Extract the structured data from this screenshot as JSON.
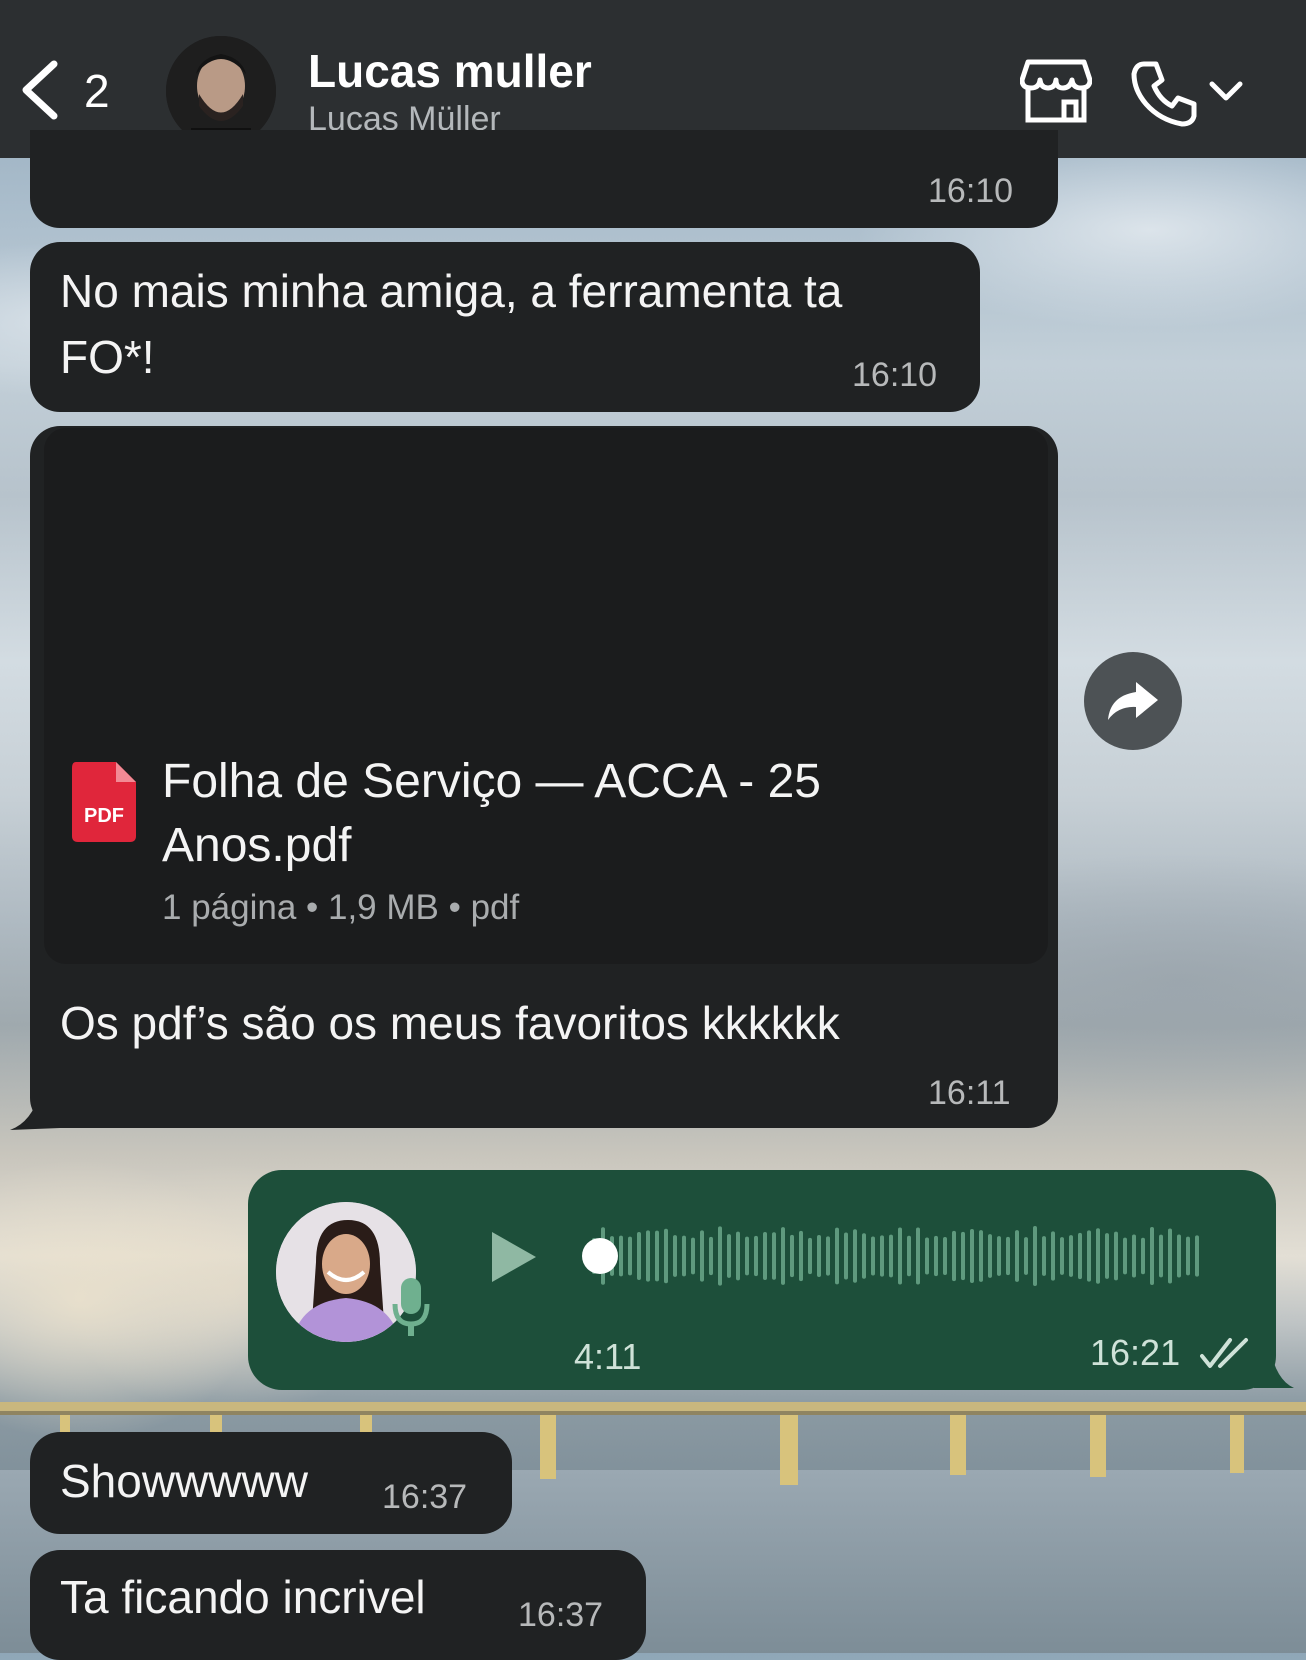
{
  "header": {
    "back_count": "2",
    "contact_name": "Lucas muller",
    "contact_subtitle": "Lucas Müller"
  },
  "messages": [
    {
      "time": "16:10"
    },
    {
      "text": "No mais minha amiga, a ferramenta ta FO*!",
      "line1": "No mais minha amiga, a ferramenta ta",
      "line2": "FO*!",
      "time": "16:10"
    },
    {
      "attachment": {
        "name_line1": "Folha de Serviço — ACCA - 25",
        "name_line2": "Anos.pdf",
        "meta": "1 página • 1,9 MB • pdf",
        "badge": "PDF"
      },
      "caption": "Os pdf’s são os meus favoritos kkkkkk",
      "time": "16:11"
    },
    {
      "voice": {
        "duration": "4:11",
        "time": "16:21",
        "status": "read",
        "progress": 0.0
      }
    },
    {
      "text": "Showwwww",
      "time": "16:37"
    },
    {
      "text": "Ta ficando incrivel",
      "time": "16:37"
    }
  ],
  "colors": {
    "header_bg": "#2c2f31",
    "incoming_bubble": "#202223",
    "outgoing_bubble": "#1d4f3a",
    "pdf_red": "#e0263b"
  }
}
